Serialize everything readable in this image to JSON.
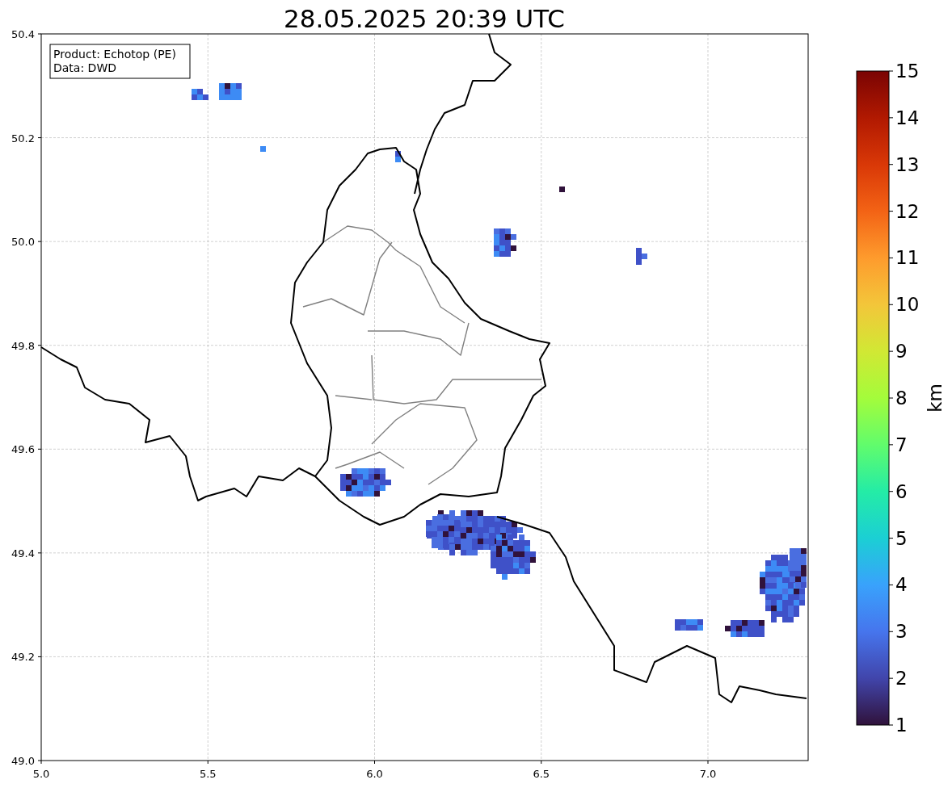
{
  "title": "28.05.2025 20:39 UTC",
  "annotation": {
    "lines": [
      "Product: Echotop (PE)",
      "Data: DWD"
    ]
  },
  "x_axis": {
    "ticks": [
      "5.0",
      "5.5",
      "6.0",
      "6.5",
      "7.0"
    ]
  },
  "y_axis": {
    "ticks": [
      "50.4",
      "50.2",
      "50.0",
      "49.8",
      "49.6",
      "49.4",
      "49.2",
      "49.0"
    ]
  },
  "colorbar": {
    "label": "km",
    "ticks": [
      "15",
      "14",
      "13",
      "12",
      "11",
      "10",
      "9",
      "8",
      "7",
      "6",
      "5",
      "4",
      "3",
      "2",
      "1"
    ]
  }
}
